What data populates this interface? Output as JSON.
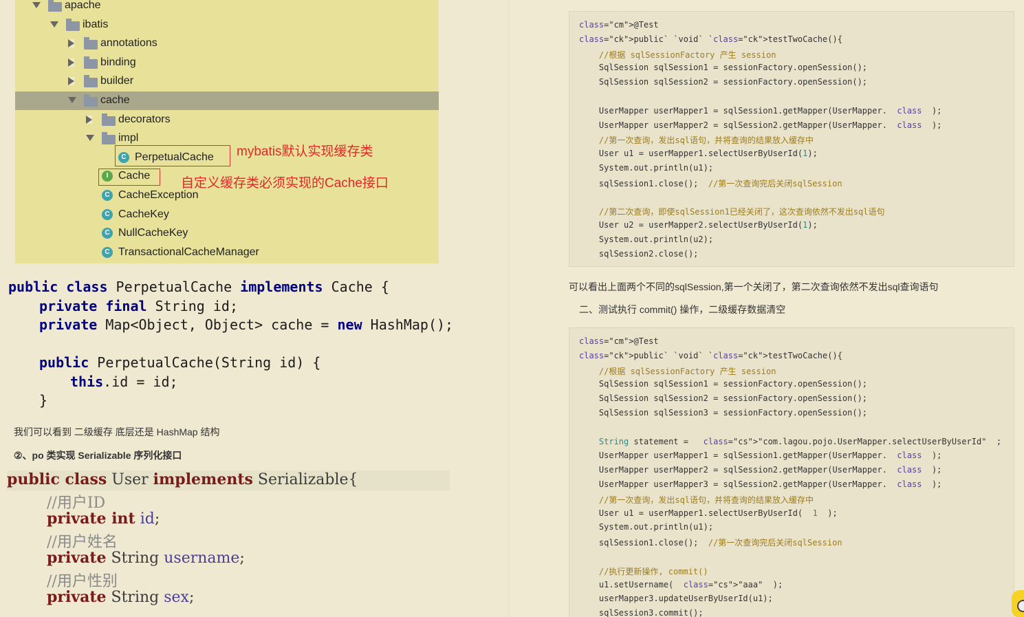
{
  "tree": {
    "items": [
      {
        "label": "apache",
        "kind": "folder",
        "expanded": true
      },
      {
        "label": "ibatis",
        "kind": "folder",
        "expanded": true
      },
      {
        "label": "annotations",
        "kind": "folder",
        "expanded": false
      },
      {
        "label": "binding",
        "kind": "folder",
        "expanded": false
      },
      {
        "label": "builder",
        "kind": "folder",
        "expanded": false
      },
      {
        "label": "cache",
        "kind": "folder",
        "expanded": true,
        "selected": true
      },
      {
        "label": "decorators",
        "kind": "folder",
        "expanded": false
      },
      {
        "label": "impl",
        "kind": "folder",
        "expanded": true
      },
      {
        "label": "PerpetualCache",
        "kind": "class",
        "badge": "C"
      },
      {
        "label": "Cache",
        "kind": "interface",
        "badge": "I"
      },
      {
        "label": "CacheException",
        "kind": "class",
        "badge": "C"
      },
      {
        "label": "CacheKey",
        "kind": "class",
        "badge": "C"
      },
      {
        "label": "NullCacheKey",
        "kind": "class",
        "badge": "C"
      },
      {
        "label": "TransactionalCacheManager",
        "kind": "class",
        "badge": "C"
      }
    ],
    "annotation1": "mybatis默认实现缓存类",
    "annotation2": "自定义缓存类必须实现的Cache接口"
  },
  "code1": {
    "l1a": "public class",
    "l1b": " PerpetualCache ",
    "l1c": "implements",
    "l1d": " Cache {",
    "l2a": "private final",
    "l2b": " String id;",
    "l3a": "private",
    "l3b": " Map<Object, Object> cache = ",
    "l3c": "new",
    "l3d": " HashMap();",
    "l4a": "public",
    "l4b": " PerpetualCache(String id) {",
    "l5a": "this",
    "l5b": ".id = id;",
    "l6": "}"
  },
  "text1": "我们可以看到 二级缓存 底层还是 HashMap 结构",
  "text2": "②、po 类实现 Serializable 序列化接口",
  "code2": {
    "l1a": "public class",
    "l1b": " User ",
    "l1c": "implements",
    "l1d": " Serializable",
    "l1e": "{",
    "c1": "//用户ID",
    "l2a": "private int",
    "l2b": " id",
    "c2": "//用户姓名",
    "l3a": "private",
    "l3b": " String ",
    "l3c": "username",
    "c3": "//用户性别",
    "l4a": "private",
    "l4b": " String ",
    "l4c": "sex"
  },
  "block1": [
    "@Test",
    "public` `void` `testTwoCache(){",
    "    //根据 sqlSessionFactory 产生 session",
    "    SqlSession sqlSession1 = sessionFactory.openSession();",
    "    SqlSession sqlSession2 = sessionFactory.openSession();",
    "",
    "    UserMapper userMapper1 = sqlSession1.getMapper(UserMapper.  class  );",
    "    UserMapper userMapper2 = sqlSession2.getMapper(UserMapper.  class  );",
    "    //第一次查询，发出sql语句，并将查询的结果放入缓存中",
    "    User u1 = userMapper1.selectUserByUserId(1);",
    "    System.out.println(u1);",
    "    sqlSession1.close();  //第一次查询完后关闭sqlSession",
    "",
    "    //第二次查询，即使sqlSession1已经关闭了，这次查询依然不发出sql语句",
    "    User u2 = userMapper2.selectUserByUserId(1);",
    "    System.out.println(u2);",
    "    sqlSession2.close();"
  ],
  "text3": "可以看出上面两个不同的sqlSession,第一个关闭了，第二次查询依然不发出sql查询语句",
  "text4": "二、测试执行 commit() 操作，二级缓存数据清空",
  "block2": [
    "@Test",
    "public` `void` `testTwoCache(){",
    "    //根据 sqlSessionFactory 产生 session",
    "    SqlSession sqlSession1 = sessionFactory.openSession();",
    "    SqlSession sqlSession2 = sessionFactory.openSession();",
    "    SqlSession sqlSession3 = sessionFactory.openSession();",
    "",
    "    String statement =   \"com.lagou.pojo.UserMapper.selectUserByUserId\"  ;",
    "    UserMapper userMapper1 = sqlSession1.getMapper(UserMapper.  class  );",
    "    UserMapper userMapper2 = sqlSession2.getMapper(UserMapper.  class  );",
    "    UserMapper userMapper3 = sqlSession2.getMapper(UserMapper.  class  );",
    "    //第一次查询，发出sql语句，并将查询的结果放入缓存中",
    "    User u1 = userMapper1.selectUserByUserId(  1  );",
    "    System.out.println(u1);",
    "    sqlSession1.close();  //第一次查询完后关闭sqlSession",
    "",
    "    //执行更新操作, commit()",
    "    u1.setUsername(  \"aaa\"  );",
    "    userMapper3.updateUserByUserId(u1);",
    "    sqlSession3.commit();"
  ]
}
